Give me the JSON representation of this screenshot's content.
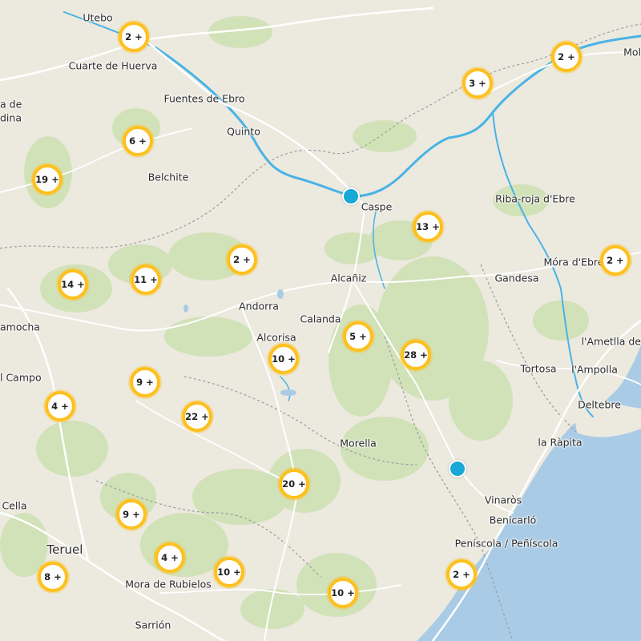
{
  "places": [
    {
      "id": "utebo",
      "name": "Utebo"
    },
    {
      "id": "cuarte",
      "name": "Cuarte de Huerva"
    },
    {
      "id": "fuentes",
      "name": "Fuentes de Ebro"
    },
    {
      "id": "quinto",
      "name": "Quinto"
    },
    {
      "id": "belchite",
      "name": "Belchite"
    },
    {
      "id": "caspe",
      "name": "Caspe"
    },
    {
      "id": "riba",
      "name": "Riba-roja d'Ebre"
    },
    {
      "id": "mora",
      "name": "Móra d'Ebre"
    },
    {
      "id": "gandesa",
      "name": "Gandesa"
    },
    {
      "id": "alcaniz",
      "name": "Alcañiz"
    },
    {
      "id": "andorra",
      "name": "Andorra"
    },
    {
      "id": "calanda",
      "name": "Calanda"
    },
    {
      "id": "alcorisa",
      "name": "Alcorisa"
    },
    {
      "id": "tortosa",
      "name": "Tortosa"
    },
    {
      "id": "ametlla",
      "name": "l'Ametlla de"
    },
    {
      "id": "ampolla",
      "name": "l'Ampolla"
    },
    {
      "id": "deltebre",
      "name": "Deltebre"
    },
    {
      "id": "rapita",
      "name": "la Ràpita"
    },
    {
      "id": "morella",
      "name": "Morella"
    },
    {
      "id": "vinaros",
      "name": "Vinaròs"
    },
    {
      "id": "benicarlo",
      "name": "Benicarló"
    },
    {
      "id": "peniscola",
      "name": "Peníscola / Peñíscola"
    },
    {
      "id": "teruel",
      "name": "Teruel"
    },
    {
      "id": "cella",
      "name": "Cella"
    },
    {
      "id": "mora_rub",
      "name": "Mora de Rubielos"
    },
    {
      "id": "sarrion",
      "name": "Sarrión"
    },
    {
      "id": "campo",
      "name": "l Campo"
    },
    {
      "id": "amocha",
      "name": "amocha"
    },
    {
      "id": "ade",
      "name": "a de"
    },
    {
      "id": "dina",
      "name": "dina"
    },
    {
      "id": "mol",
      "name": "Mol"
    }
  ],
  "clusters": [
    {
      "id": "c-zaragoza",
      "label": "2 +"
    },
    {
      "id": "c-ne",
      "label": "2 +"
    },
    {
      "id": "c-mequinenza",
      "label": "3 +"
    },
    {
      "id": "c-west",
      "label": "6 +"
    },
    {
      "id": "c-farwest",
      "label": "19 +"
    },
    {
      "id": "c-caspe-se",
      "label": "13 +"
    },
    {
      "id": "c-andorra-n",
      "label": "2 +"
    },
    {
      "id": "c-mora",
      "label": "2 +"
    },
    {
      "id": "c-14",
      "label": "14 +"
    },
    {
      "id": "c-11",
      "label": "11 +"
    },
    {
      "id": "c-calanda",
      "label": "5 +"
    },
    {
      "id": "c-28",
      "label": "28 +"
    },
    {
      "id": "c-alcorisa",
      "label": "10 +"
    },
    {
      "id": "c-9a",
      "label": "9 +"
    },
    {
      "id": "c-4a",
      "label": "4 +"
    },
    {
      "id": "c-22",
      "label": "22 +"
    },
    {
      "id": "c-20",
      "label": "20 +"
    },
    {
      "id": "c-9b",
      "label": "9 +"
    },
    {
      "id": "c-4b",
      "label": "4 +"
    },
    {
      "id": "c-8",
      "label": "8 +"
    },
    {
      "id": "c-10b",
      "label": "10 +"
    },
    {
      "id": "c-10c",
      "label": "10 +"
    },
    {
      "id": "c-peniscola",
      "label": "2 +"
    }
  ],
  "colors": {
    "land": "#ece9df",
    "sea": "#a9cbe6",
    "forest": "#cfe1b4",
    "river": "#48b3e6",
    "cluster_ring": "#fdc01e",
    "poi": "#1aa8d6"
  }
}
